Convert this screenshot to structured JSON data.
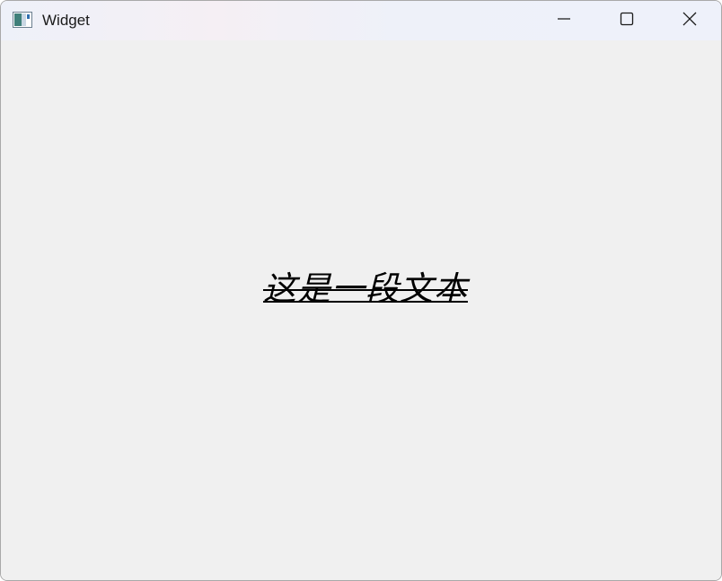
{
  "window": {
    "title": "Widget",
    "icon": "app-window-icon",
    "controls": {
      "minimize": "minimize-icon",
      "maximize": "maximize-icon",
      "close": "close-icon"
    }
  },
  "content": {
    "text": "这是一段文本",
    "text_style": {
      "italic": true,
      "underline": true,
      "strikethrough": true,
      "color": "#000000"
    }
  },
  "colors": {
    "background": "#f0f0f0",
    "titlebar": "#eef1f9"
  }
}
